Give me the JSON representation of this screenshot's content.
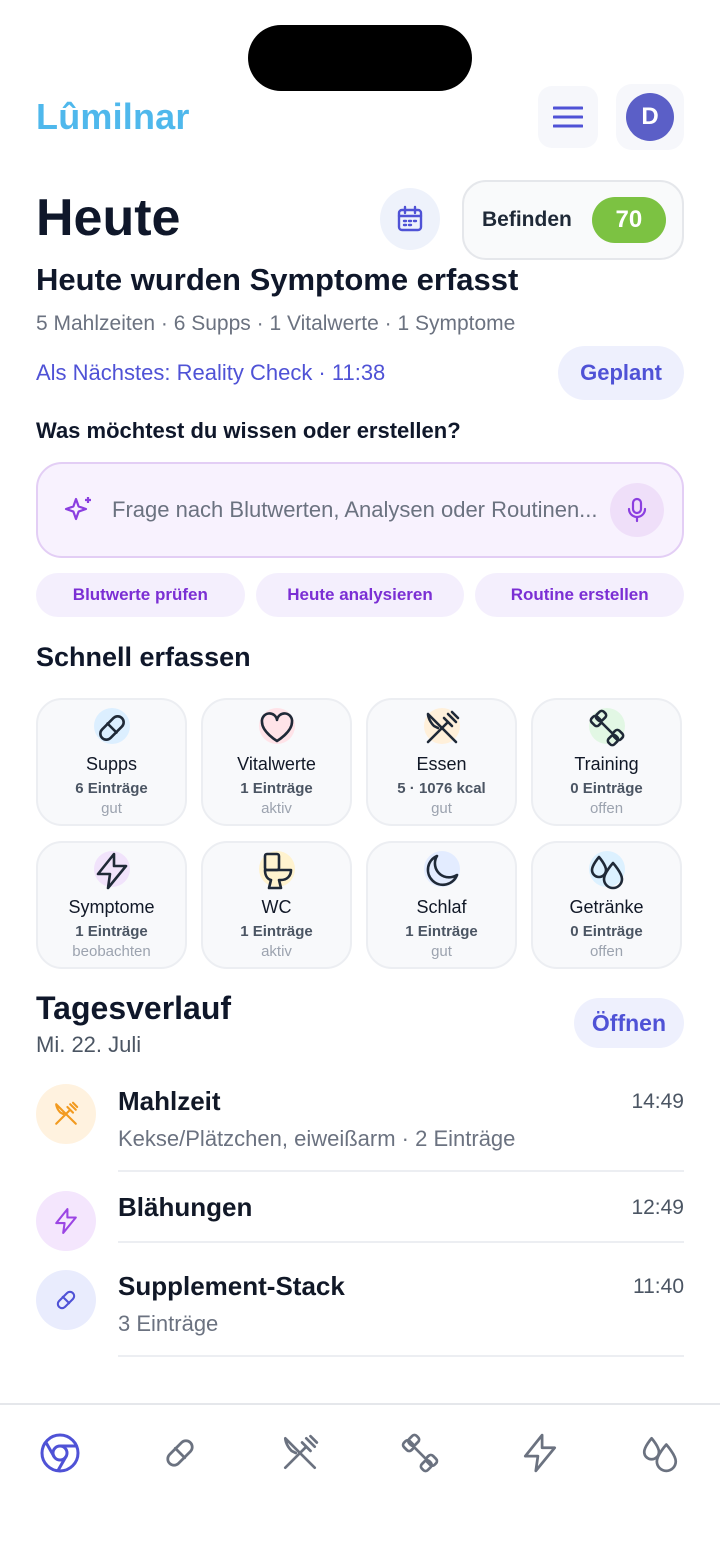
{
  "app": {
    "brand": "Lûmilnar",
    "avatar_initial": "D"
  },
  "header": {
    "title": "Heute",
    "befinden_label": "Befinden",
    "befinden_score": "70",
    "score_color": "#7cc242"
  },
  "status": {
    "headline": "Heute wurden Symptome erfasst",
    "summary": "5 Mahlzeiten · 6 Supps · 1 Vitalwerte · 1 Symptome",
    "next": "Als Nächstes: Reality Check · 11:38",
    "next_button": "Geplant"
  },
  "assistant": {
    "question": "Was möchtest du wissen oder erstellen?",
    "placeholder": "Frage nach Blutwerten, Analysen oder Routinen...",
    "chips": [
      "Blutwerte prüfen",
      "Heute analysieren",
      "Routine erstellen"
    ]
  },
  "quick_capture": {
    "title": "Schnell erfassen",
    "tiles": [
      {
        "name": "Supps",
        "stat": "6 Einträge",
        "status": "gut",
        "icon": "pill-icon"
      },
      {
        "name": "Vitalwerte",
        "stat": "1 Einträge",
        "status": "aktiv",
        "icon": "heart-icon"
      },
      {
        "name": "Essen",
        "stat": "5 · 1076 kcal",
        "status": "gut",
        "icon": "utensils-icon"
      },
      {
        "name": "Training",
        "stat": "0 Einträge",
        "status": "offen",
        "icon": "dumbbell-icon"
      },
      {
        "name": "Symptome",
        "stat": "1 Einträge",
        "status": "beobachten",
        "icon": "lightning-icon"
      },
      {
        "name": "WC",
        "stat": "1 Einträge",
        "status": "aktiv",
        "icon": "toilet-icon"
      },
      {
        "name": "Schlaf",
        "stat": "1 Einträge",
        "status": "gut",
        "icon": "moon-icon"
      },
      {
        "name": "Getränke",
        "stat": "0 Einträge",
        "status": "offen",
        "icon": "droplets-icon"
      }
    ]
  },
  "timeline": {
    "title": "Tagesverlauf",
    "date": "Mi. 22. Juli",
    "open_button": "Öffnen",
    "entries": [
      {
        "title": "Mahlzeit",
        "subtitle": "Kekse/Plätzchen, eiweißarm · 2 Einträge",
        "time": "14:49",
        "icon": "utensils-icon"
      },
      {
        "title": "Blähungen",
        "subtitle": "",
        "time": "12:49",
        "icon": "lightning-icon"
      },
      {
        "title": "Supplement-Stack",
        "subtitle": "3 Einträge",
        "time": "11:40",
        "icon": "pill-icon"
      }
    ]
  },
  "bottom_nav": [
    "home-icon",
    "pill-icon",
    "utensils-icon",
    "dumbbell-icon",
    "lightning-icon",
    "droplets-icon"
  ],
  "colors": {
    "brand": "#4fb8ec",
    "accent": "#4f52d6",
    "assistant": "#7b2fd4"
  }
}
